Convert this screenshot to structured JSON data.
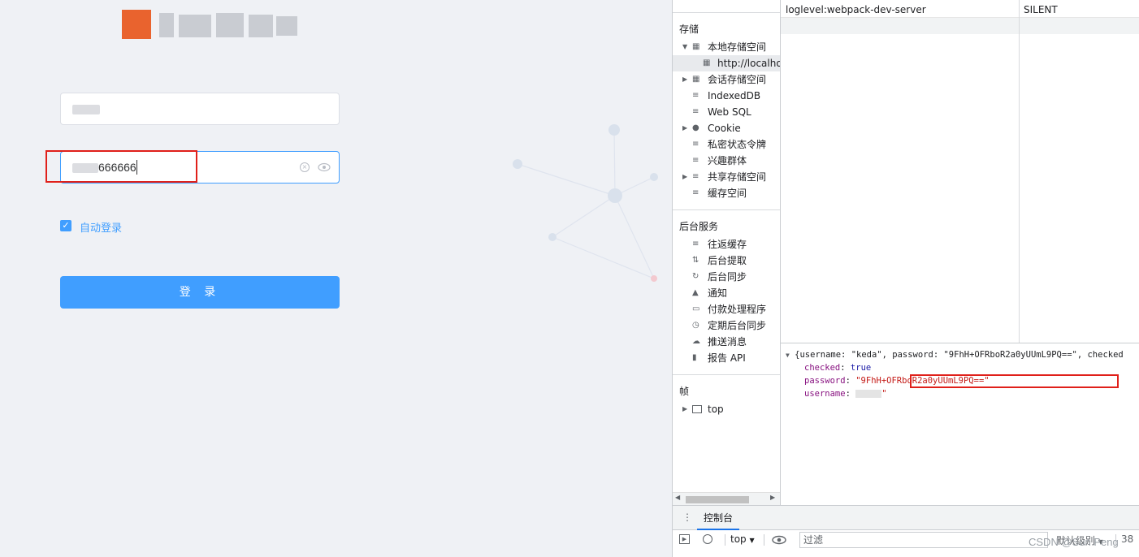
{
  "login": {
    "password_value": "666666",
    "remember_label": "自动登录",
    "submit_label": "登 录"
  },
  "devtools": {
    "sidebar": {
      "storage_header": "存储",
      "storage_items": [
        {
          "label": "本地存储空间",
          "icon": "grid-icon",
          "expandable": true,
          "expanded": true
        },
        {
          "label": "http://localhos",
          "icon": "grid-icon",
          "selected": true
        },
        {
          "label": "会话存储空间",
          "icon": "grid-icon",
          "expandable": true
        },
        {
          "label": "IndexedDB",
          "icon": "database-icon"
        },
        {
          "label": "Web SQL",
          "icon": "database-icon"
        },
        {
          "label": "Cookie",
          "icon": "cookie-icon",
          "expandable": true
        },
        {
          "label": "私密状态令牌",
          "icon": "database-icon"
        },
        {
          "label": "兴趣群体",
          "icon": "database-icon"
        },
        {
          "label": "共享存储空间",
          "icon": "database-icon",
          "expandable": true
        },
        {
          "label": "缓存空间",
          "icon": "database-icon"
        }
      ],
      "background_header": "后台服务",
      "background_items": [
        {
          "label": "往返缓存",
          "icon": "database-icon"
        },
        {
          "label": "后台提取",
          "icon": "fetch-arrows-icon"
        },
        {
          "label": "后台同步",
          "icon": "sync-icon"
        },
        {
          "label": "通知",
          "icon": "bell-icon"
        },
        {
          "label": "付款处理程序",
          "icon": "card-icon"
        },
        {
          "label": "定期后台同步",
          "icon": "clock-icon"
        },
        {
          "label": "推送消息",
          "icon": "cloud-icon"
        },
        {
          "label": "报告 API",
          "icon": "document-icon"
        }
      ],
      "frames_header": "帧",
      "frames_items": [
        {
          "label": "top",
          "icon": "window-icon",
          "expandable": true
        }
      ]
    },
    "storage_table": {
      "rows": [
        {
          "key": "loglevel:webpack-dev-server",
          "value": "SILENT"
        }
      ]
    },
    "preview": {
      "summary": "{username: \"keda\", password: \"9FhH+OFRboR2a0yUUmL9PQ==\", checked",
      "checked_key": "checked",
      "checked_value": "true",
      "password_key": "password",
      "password_value": "\"9FhH+OFRboR2a0yUUmL9PQ==\"",
      "username_key": "username",
      "username_tail": "\""
    },
    "drawer": {
      "console_tab": "控制台",
      "context": "top",
      "filter_placeholder": "过滤",
      "level": "默认级别",
      "issues": "38"
    }
  },
  "watermark": "CSDN @Sun  Peng"
}
